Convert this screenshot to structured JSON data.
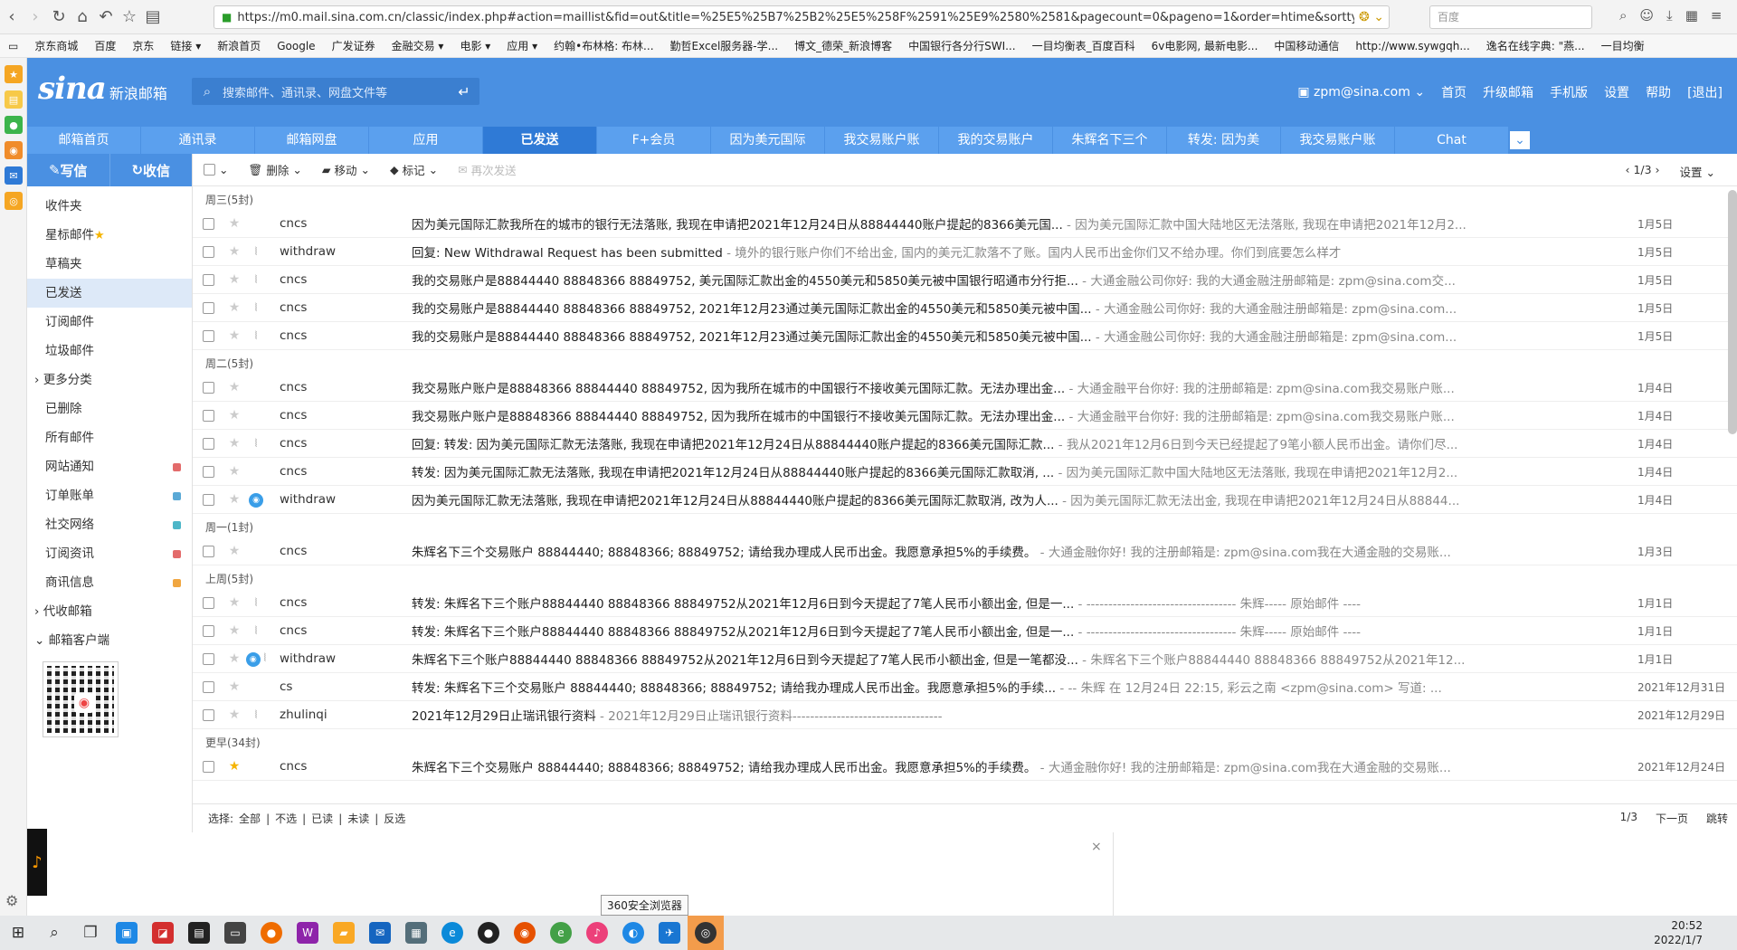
{
  "browser": {
    "url": "https://m0.mail.sina.com.cn/classic/index.php#action=maillist&fid=out&title=%25E5%25B7%25B2%25E5%258F%2591%25E9%2580%2581&pagecount=0&pageno=1&order=htime&sorttype",
    "search_placeholder": "百度",
    "bookmarks": [
      "京东商城",
      "百度",
      "京东",
      "链接 ▾",
      "新浪首页",
      "Google",
      "广发证券",
      "金融交易 ▾",
      "电影 ▾",
      "应用 ▾",
      "约翰•布林格: 布林...",
      "勤哲Excel服务器-学...",
      "博文_德荣_新浪博客",
      "中国银行各分行SWI...",
      "一目均衡表_百度百科",
      "6v电影网, 最新电影...",
      "中国移动通信",
      "http://www.sywgqh...",
      "逸名在线字典: \"燕...",
      "一目均衡"
    ]
  },
  "header": {
    "logo": "sina",
    "logo_sub": "新浪邮箱",
    "search_placeholder": "搜索邮件、通讯录、网盘文件等",
    "user": "zpm@sina.com ⌄",
    "links": [
      "首页",
      "升级邮箱",
      "手机版",
      "设置",
      "帮助",
      "[退出]"
    ]
  },
  "tabs": [
    {
      "label": "邮箱首页",
      "w": 126
    },
    {
      "label": "通讯录",
      "w": 126
    },
    {
      "label": "邮箱网盘",
      "w": 126
    },
    {
      "label": "应用",
      "w": 126
    },
    {
      "label": "已发送",
      "w": 126,
      "active": true
    },
    {
      "label": "F+会员",
      "w": 126
    },
    {
      "label": "因为美元国际",
      "w": 126
    },
    {
      "label": "我交易账户账",
      "w": 126
    },
    {
      "label": "我的交易账户",
      "w": 126
    },
    {
      "label": "朱辉名下三个",
      "w": 126
    },
    {
      "label": "转发: 因为美",
      "w": 126
    },
    {
      "label": "我交易账户账",
      "w": 126
    },
    {
      "label": "Chat",
      "w": 126
    }
  ],
  "sidebar": {
    "write": "写信",
    "receive": "收信",
    "folders": [
      {
        "label": "收件夹"
      },
      {
        "label": "星标邮件",
        "star": true
      },
      {
        "label": "草稿夹"
      },
      {
        "label": "已发送",
        "active": true
      },
      {
        "label": "订阅邮件"
      },
      {
        "label": "垃圾邮件"
      },
      {
        "label": "› 更多分类",
        "group": true
      },
      {
        "label": "已删除"
      },
      {
        "label": "所有邮件"
      },
      {
        "label": "网站通知",
        "dot": "#e36b6b"
      },
      {
        "label": "订单账单",
        "dot": "#5aa9d6"
      },
      {
        "label": "社交网络",
        "dot": "#4db6c8"
      },
      {
        "label": "订阅资讯",
        "dot": "#e36b6b"
      },
      {
        "label": "商讯信息",
        "dot": "#f0a640"
      },
      {
        "label": "› 代收邮箱",
        "group": true
      },
      {
        "label": "⌄ 邮箱客户端",
        "group": true
      }
    ]
  },
  "toolbar": {
    "delete": "删除",
    "move": "移动",
    "mark": "标记",
    "resend": "再次发送",
    "page": "1/3",
    "settings": "设置 ⌄"
  },
  "groups": [
    {
      "label": "周三(5封)",
      "rows": [
        {
          "from": "cncs",
          "att": false,
          "subject": "因为美元国际汇款我所在的城市的银行无法落账, 我现在申请把2021年12月24日从88844440账户提起的8366美元国...",
          "preview": " - 因为美元国际汇款中国大陆地区无法落账, 我现在申请把2021年12月2...",
          "date": "1月5日"
        },
        {
          "from": "withdraw",
          "att": true,
          "subject": "回复: New Withdrawal Request has been submitted",
          "preview": " - 境外的银行账户你们不给出金, 国内的美元汇款落不了账。国内人民币出金你们又不给办理。你们到底要怎么样才",
          "date": "1月5日"
        },
        {
          "from": "cncs",
          "att": true,
          "subject": "我的交易账户是88844440 88848366 88849752, 美元国际汇款出金的4550美元和5850美元被中国银行昭通市分行拒...",
          "preview": " - 大通金融公司你好: 我的大通金融注册邮箱是: zpm@sina.com交...",
          "date": "1月5日"
        },
        {
          "from": "cncs",
          "att": true,
          "subject": "我的交易账户是88844440 88848366 88849752, 2021年12月23通过美元国际汇款出金的4550美元和5850美元被中国...",
          "preview": " - 大通金融公司你好: 我的大通金融注册邮箱是: zpm@sina.com...",
          "date": "1月5日"
        },
        {
          "from": "cncs",
          "att": true,
          "subject": "我的交易账户是88844440 88848366 88849752, 2021年12月23通过美元国际汇款出金的4550美元和5850美元被中国...",
          "preview": " - 大通金融公司你好: 我的大通金融注册邮箱是: zpm@sina.com...",
          "date": "1月5日"
        }
      ]
    },
    {
      "label": "周二(5封)",
      "rows": [
        {
          "from": "cncs",
          "att": false,
          "subject": "我交易账户账户是88848366 88844440 88849752, 因为我所在城市的中国银行不接收美元国际汇款。无法办理出金...",
          "preview": " - 大通金融平台你好: 我的注册邮箱是: zpm@sina.com我交易账户账...",
          "date": "1月4日"
        },
        {
          "from": "cncs",
          "att": false,
          "subject": "我交易账户账户是88848366 88844440 88849752, 因为我所在城市的中国银行不接收美元国际汇款。无法办理出金...",
          "preview": " - 大通金融平台你好: 我的注册邮箱是: zpm@sina.com我交易账户账...",
          "date": "1月4日"
        },
        {
          "from": "cncs",
          "att": true,
          "subject": "回复: 转发: 因为美元国际汇款无法落账, 我现在申请把2021年12月24日从88844440账户提起的8366美元国际汇款...",
          "preview": " - 我从2021年12月6日到今天已经提起了9笔小额人民币出金。请你们尽...",
          "date": "1月4日"
        },
        {
          "from": "cncs",
          "att": false,
          "subject": "转发: 因为美元国际汇款无法落账, 我现在申请把2021年12月24日从88844440账户提起的8366美元国际汇款取消, ...",
          "preview": " - 因为美元国际汇款中国大陆地区无法落账, 我现在申请把2021年12月2...",
          "date": "1月4日"
        },
        {
          "from": "withdraw",
          "att": false,
          "qq": true,
          "subject": "因为美元国际汇款无法落账, 我现在申请把2021年12月24日从88844440账户提起的8366美元国际汇款取消, 改为人...",
          "preview": " - 因为美元国际汇款无法出金, 我现在申请把2021年12月24日从88844...",
          "date": "1月4日"
        }
      ]
    },
    {
      "label": "周一(1封)",
      "rows": [
        {
          "from": "cncs",
          "att": false,
          "subject": "朱辉名下三个交易账户 88844440; 88848366; 88849752; 请给我办理成人民币出金。我愿意承担5%的手续费。",
          "preview": " - 大通金融你好! 我的注册邮箱是: zpm@sina.com我在大通金融的交易账...",
          "date": "1月3日"
        }
      ]
    },
    {
      "label": "上周(5封)",
      "rows": [
        {
          "from": "cncs",
          "att": true,
          "subject": "转发: 朱辉名下三个账户88844440 88848366 88849752从2021年12月6日到今天提起了7笔人民币小额出金, 但是一...",
          "preview": " - ---------------------------------- 朱辉----- 原始邮件 ----",
          "date": "1月1日"
        },
        {
          "from": "cncs",
          "att": true,
          "subject": "转发: 朱辉名下三个账户88844440 88848366 88849752从2021年12月6日到今天提起了7笔人民币小额出金, 但是一...",
          "preview": " - ---------------------------------- 朱辉----- 原始邮件 ----",
          "date": "1月1日"
        },
        {
          "from": "withdraw",
          "att": true,
          "qq": true,
          "subject": "朱辉名下三个账户88844440 88848366 88849752从2021年12月6日到今天提起了7笔人民币小额出金, 但是一笔都没...",
          "preview": " - 朱辉名下三个账户88844440 88848366 88849752从2021年12...",
          "date": "1月1日"
        },
        {
          "from": "cs",
          "att": false,
          "subject": "转发: 朱辉名下三个交易账户 88844440; 88848366; 88849752; 请给我办理成人民币出金。我愿意承担5%的手续...",
          "preview": " - -- 朱辉 在 12月24日 22:15, 彩云之南 <zpm@sina.com> 写道: ...",
          "date": "2021年12月31日"
        },
        {
          "from": "zhulinqi",
          "att": true,
          "subject": "2021年12月29日止瑞讯银行资料",
          "preview": " - 2021年12月29日止瑞讯银行资料----------------------------------",
          "date": "2021年12月29日"
        }
      ]
    },
    {
      "label": "更早(34封)",
      "rows": [
        {
          "from": "cncs",
          "att": false,
          "starred": true,
          "subject": "朱辉名下三个交易账户 88844440; 88848366; 88849752; 请给我办理成人民币出金。我愿意承担5%的手续费。",
          "preview": " - 大通金融你好! 我的注册邮箱是: zpm@sina.com我在大通金融的交易账...",
          "date": "2021年12月24日"
        }
      ]
    }
  ],
  "footer": {
    "select_label": "选择:",
    "select_opts": [
      "全部",
      "|",
      "不选",
      "|",
      "已读",
      "|",
      "未读",
      "|",
      "反选"
    ],
    "page": "1/3",
    "next": "下一页",
    "jump": "跳转"
  },
  "tooltip": "360安全浏览器",
  "clock": {
    "time": "20:52",
    "date": "2022/1/7"
  }
}
